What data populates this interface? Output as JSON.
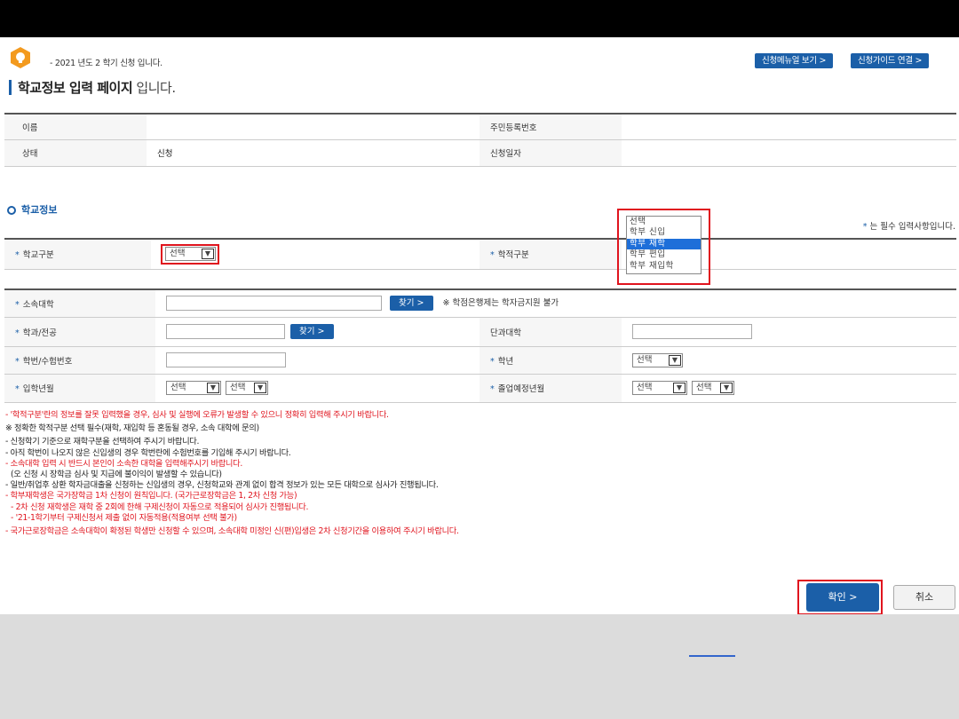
{
  "notice": {
    "text": "- 2021 년도 2 학기 신청 입니다."
  },
  "top_buttons": {
    "manual": "신청메뉴얼 보기 >",
    "guide": "신청가이드 연결 >"
  },
  "page_title": {
    "bold": "학교정보 입력 페이지",
    "light": " 입니다."
  },
  "info_table": {
    "name_label": "이름",
    "name_value": "",
    "rrn_label": "주민등록번호",
    "rrn_value": "",
    "status_label": "상태",
    "status_value": "신청",
    "date_label": "신청일자",
    "date_value": ""
  },
  "section": {
    "title": "학교정보",
    "required_note_star": "*",
    "required_note": " 는 필수 입력사항입니다."
  },
  "school_type": {
    "label": "학교구분",
    "selected": "선택"
  },
  "enroll_type": {
    "label": "학적구분",
    "options": [
      "선택",
      "학부 신입",
      "학부 재학",
      "학부 편입",
      "학부 재입학"
    ],
    "highlighted": "학부 재학"
  },
  "form": {
    "university_label": "소속대학",
    "find_button": "찾기 >",
    "bank_note": "※ 학점은행제는 학자금지원 불가",
    "major_label": "학과/전공",
    "college_label": "단과대학",
    "student_id_label": "학번/수험번호",
    "grade_label": "학년",
    "grade_selected": "선택",
    "admission_label": "입학년월",
    "admission_year": "선택",
    "admission_month": "선택",
    "graduation_label": "졸업예정년월",
    "graduation_year": "선택",
    "graduation_month": "선택"
  },
  "notes": [
    "- '학적구분'란의 정보를 잘못 입력했을 경우, 심사 및 실행에 오류가 발생할 수 있으니 정확히 입력해 주시기 바랍니다.",
    "※ 정확한 학적구분 선택 필수(재학, 재입학 등 혼동될 경우, 소속 대학에 문의)",
    "- 신청학기 기준으로 재학구분을 선택하여 주시기 바랍니다.",
    "- 아직 학번이 나오지 않은 신입생의 경우 학번란에 수험번호를 기입해 주시기 바랍니다.",
    "- 소속대학 입력 시 반드시 본인이 소속한 대학을 입력해주시기 바랍니다.",
    "(오 신청 시 장학금 심사 및 지급에 불이익이 발생할 수 있습니다)",
    "- 일반/취업후 상환 학자금대출을 신청하는 신입생의 경우, 신청학교와 관계 없이 합격 정보가 있는 모든 대학으로 심사가 진행됩니다.",
    "- 학부재학생은 국가장학금 1차 신청이 원칙입니다. (국가근로장학금은 1, 2차 신청 가능)",
    "- 2차 신청 재학생은 재학 중 2회에 한해 구제신청이 자동으로 적용되어 심사가 진행됩니다.",
    "- '21-1학기부터 구제신청서 제출 없이 자동적용(적용여부 선택 불가)",
    "- 국가근로장학금은 소속대학이 확정된 학생만 신청할 수 있으며, 소속대학 미정인 신(편)입생은 2차 신청기간을 이용하여 주시기 바랍니다."
  ],
  "buttons": {
    "confirm": "확인 >",
    "cancel": "취소"
  },
  "colors": {
    "accent": "#1b5fa8",
    "highlight": "#e0141e",
    "warning_text": "#e0141e"
  }
}
